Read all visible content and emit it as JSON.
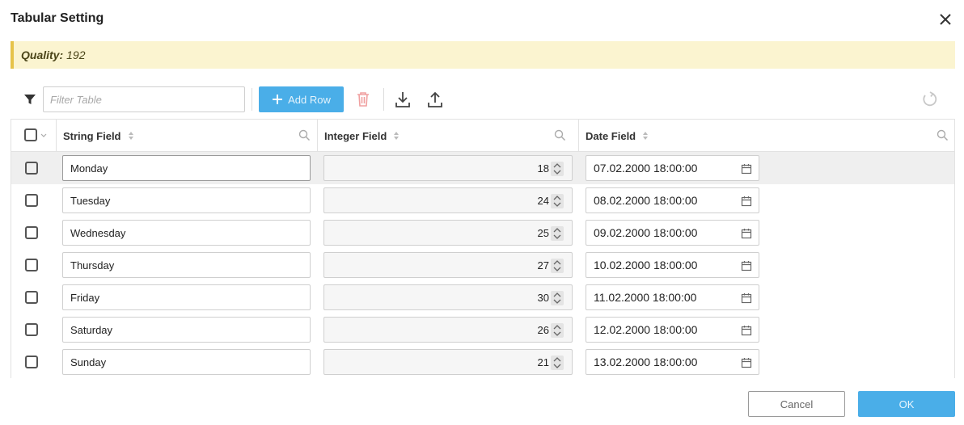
{
  "dialog": {
    "title": "Tabular Setting",
    "close_icon": "close-icon"
  },
  "banner": {
    "label": "Quality:",
    "value": "192",
    "accent": "#e6c34a"
  },
  "toolbar": {
    "filter_placeholder": "Filter Table",
    "filter_value": "",
    "add_row_label": "Add Row",
    "icons": [
      "filter-icon",
      "plus-icon",
      "trash-icon",
      "download-icon",
      "upload-icon",
      "reset-icon"
    ]
  },
  "table": {
    "columns": [
      {
        "label": "String Field"
      },
      {
        "label": "Integer Field"
      },
      {
        "label": "Date Field"
      }
    ],
    "rows": [
      {
        "string": "Monday",
        "integer": "18",
        "date": "07.02.2000 18:00:00"
      },
      {
        "string": "Tuesday",
        "integer": "24",
        "date": "08.02.2000 18:00:00"
      },
      {
        "string": "Wednesday",
        "integer": "25",
        "date": "09.02.2000 18:00:00"
      },
      {
        "string": "Thursday",
        "integer": "27",
        "date": "10.02.2000 18:00:00"
      },
      {
        "string": "Friday",
        "integer": "30",
        "date": "11.02.2000 18:00:00"
      },
      {
        "string": "Saturday",
        "integer": "26",
        "date": "12.02.2000 18:00:00"
      },
      {
        "string": "Sunday",
        "integer": "21",
        "date": "13.02.2000 18:00:00"
      }
    ]
  },
  "footer": {
    "cancel_label": "Cancel",
    "ok_label": "OK"
  },
  "colors": {
    "primary": "#4aaee8",
    "delete_disabled": "#f0a0a0"
  }
}
